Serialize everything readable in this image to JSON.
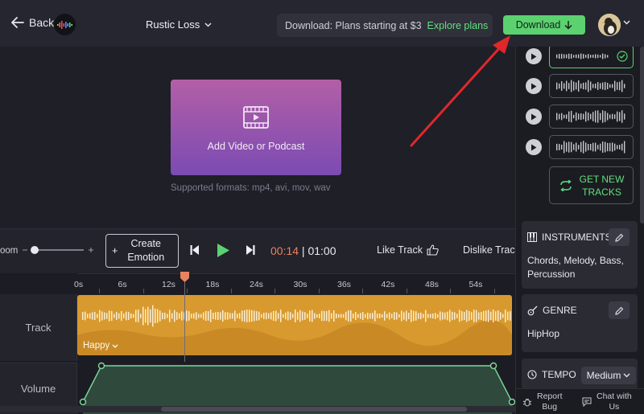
{
  "header": {
    "back_label": "Back",
    "track_title": "Rustic Loss",
    "promo_text": "Download: Plans starting at $3",
    "promo_link": "Explore plans",
    "download_label": "Download"
  },
  "preview": {
    "upload_label": "Add Video or Podcast",
    "formats": "Supported formats: mp4, avi, mov, wav"
  },
  "controls": {
    "zoom_label": "oom",
    "zoom_minus": "–",
    "zoom_plus": "+",
    "emotion_plus": "+",
    "emotion_line1": "Create",
    "emotion_line2": "Emotion",
    "current_time": "00:14",
    "separator": " | ",
    "total_time": "01:00",
    "like_label": "Like Track",
    "dislike_label": "Dislike Trac"
  },
  "timeline": {
    "ticks": [
      "0s",
      "6s",
      "12s",
      "18s",
      "24s",
      "30s",
      "36s",
      "42s",
      "48s",
      "54s"
    ],
    "track_label": "Track",
    "mood_label": "Happy",
    "volume_label": "Volume"
  },
  "sidebar": {
    "get_new_line1": "GET NEW",
    "get_new_line2": "TRACKS",
    "instruments_title": "INSTRUMENTS",
    "instruments_value": "Chords, Melody, Bass, Percussion",
    "genre_title": "GENRE",
    "genre_value": "HipHop",
    "tempo_title": "TEMPO",
    "tempo_value": "Medium",
    "report_bug_1": "Report",
    "report_bug_2": "Bug",
    "chat_1": "Chat with",
    "chat_2": "Us"
  },
  "colors": {
    "accent_green": "#5bd16f",
    "clip_orange": "#d89a2f",
    "time_orange": "#e9835f",
    "annotation_red": "#e0282a"
  }
}
